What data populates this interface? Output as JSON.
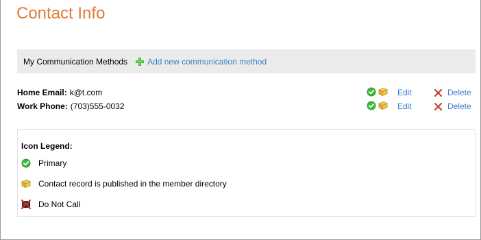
{
  "page": {
    "title": "Contact Info"
  },
  "methods_bar": {
    "label": "My Communication Methods",
    "add_label": "Add new communication method"
  },
  "contacts": [
    {
      "label": "Home Email:",
      "value": "k@t.com",
      "edit_label": "Edit",
      "delete_label": "Delete"
    },
    {
      "label": "Work Phone:",
      "value": "(703)555-0032",
      "edit_label": "Edit",
      "delete_label": "Delete"
    }
  ],
  "legend": {
    "title": "Icon Legend:",
    "items": [
      {
        "icon": "check-circle-icon",
        "label": "Primary"
      },
      {
        "icon": "book-icon",
        "label": "Contact record is published in the member directory"
      },
      {
        "icon": "no-phone-icon",
        "label": "Do Not Call"
      }
    ]
  },
  "colors": {
    "title": "#e07b3a",
    "link": "#3a7fc1",
    "bar_bg": "#ebebeb",
    "primary_green": "#2fa02f",
    "delete_red": "#c0392b"
  }
}
